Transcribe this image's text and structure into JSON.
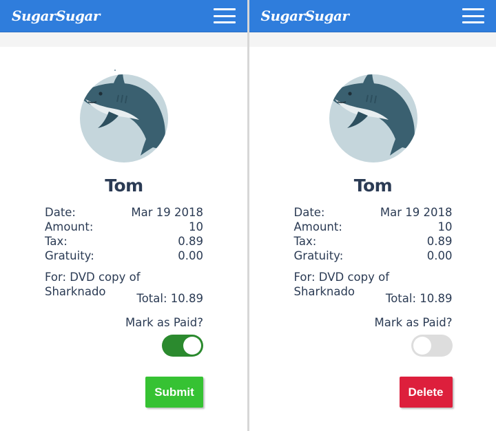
{
  "colors": {
    "navbar": "#2f7ddc",
    "toggle_on": "#2b8a2e",
    "toggle_off": "#dddddd",
    "submit": "#36c233",
    "delete": "#dd1f3c"
  },
  "panels": [
    {
      "brand": "SugarSugar",
      "menu_icon": "hamburger-icon",
      "avatar_icon": "shark-icon",
      "name": "Tom",
      "date_label": "Date:",
      "date_value": "Mar 19 2018",
      "amount_label": "Amount:",
      "amount_value": "10",
      "tax_label": "Tax:",
      "tax_value": "0.89",
      "gratuity_label": "Gratuity:",
      "gratuity_value": "0.00",
      "for_text": "For: DVD copy of Sharknado",
      "total_text": "Total: 10.89",
      "paid_label": "Mark as Paid?",
      "paid_toggle_on": true,
      "action_label": "Submit"
    },
    {
      "brand": "SugarSugar",
      "menu_icon": "hamburger-icon",
      "avatar_icon": "shark-icon",
      "name": "Tom",
      "date_label": "Date:",
      "date_value": "Mar 19 2018",
      "amount_label": "Amount:",
      "amount_value": "10",
      "tax_label": "Tax:",
      "tax_value": "0.89",
      "gratuity_label": "Gratuity:",
      "gratuity_value": "0.00",
      "for_text": "For: DVD copy of Sharknado",
      "total_text": "Total: 10.89",
      "paid_label": "Mark as Paid?",
      "paid_toggle_on": false,
      "action_label": "Delete"
    }
  ]
}
